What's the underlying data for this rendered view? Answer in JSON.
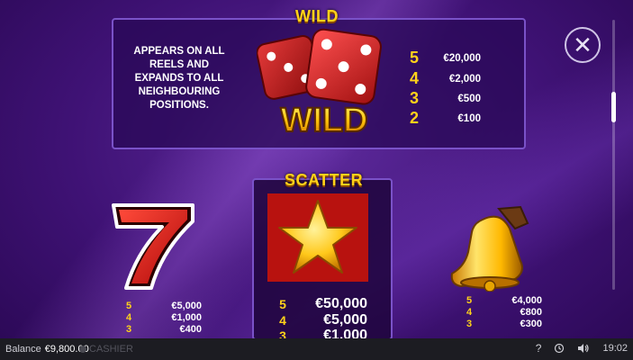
{
  "wild": {
    "title": "WILD",
    "description": "APPEARS ON ALL REELS AND EXPANDS TO ALL NEIGHBOURING POSITIONS.",
    "logo_text": "WILD",
    "pays": [
      {
        "count": "5",
        "value": "€20,000"
      },
      {
        "count": "4",
        "value": "€2,000"
      },
      {
        "count": "3",
        "value": "€500"
      },
      {
        "count": "2",
        "value": "€100"
      }
    ]
  },
  "seven": {
    "pays": [
      {
        "count": "5",
        "value": "€5,000"
      },
      {
        "count": "4",
        "value": "€1,000"
      },
      {
        "count": "3",
        "value": "€400"
      }
    ]
  },
  "scatter": {
    "title": "SCATTER",
    "pays": [
      {
        "count": "5",
        "value": "€50,000"
      },
      {
        "count": "4",
        "value": "€5,000"
      },
      {
        "count": "3",
        "value": "€1,000"
      }
    ]
  },
  "bell": {
    "pays": [
      {
        "count": "5",
        "value": "€4,000"
      },
      {
        "count": "4",
        "value": "€800"
      },
      {
        "count": "3",
        "value": "€300"
      }
    ]
  },
  "statusbar": {
    "balance_label": "Balance",
    "balance_value": "€9,800.00",
    "cashier_label": "CASHIER",
    "help_symbol": "?",
    "time": "19:02"
  },
  "icons": {
    "close": "close-icon",
    "help": "help-icon",
    "history": "history-icon",
    "sound": "sound-icon"
  },
  "colors": {
    "accent_gold": "#ffd21a",
    "panel_border": "#7a52c8",
    "background": "#3f1275",
    "status_bar": "#1c1c22"
  }
}
